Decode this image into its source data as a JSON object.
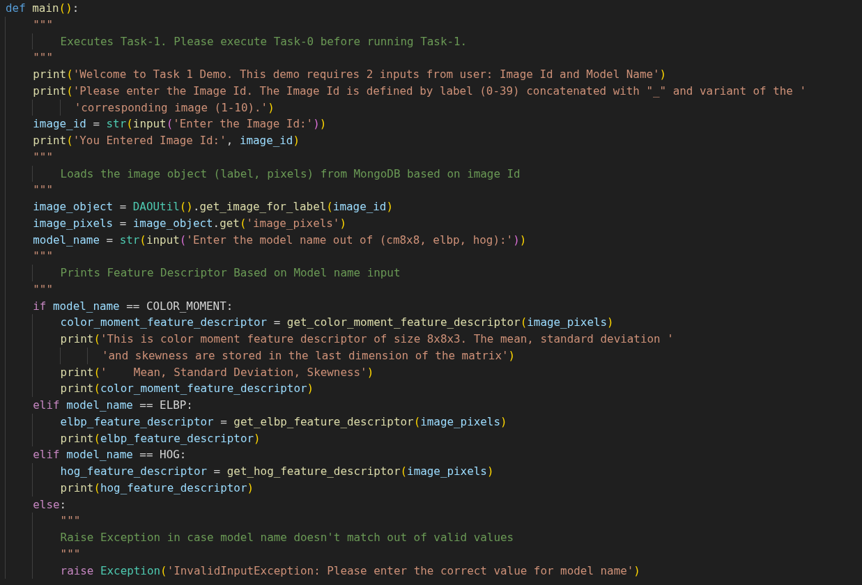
{
  "editor": {
    "lines": [
      {
        "tokens": [
          {
            "kind": "keyword",
            "text": "def "
          },
          {
            "kind": "function",
            "text": "main"
          },
          {
            "kind": "bracket1",
            "text": "()"
          },
          {
            "kind": "plain",
            "text": ":"
          }
        ]
      },
      {
        "tokens": [
          {
            "kind": "string",
            "text": "    \"\"\""
          }
        ]
      },
      {
        "tokens": [
          {
            "kind": "docstring",
            "text": "        Executes Task-1. Please execute Task-0 before running Task-1."
          }
        ]
      },
      {
        "tokens": [
          {
            "kind": "string",
            "text": "    \"\"\""
          }
        ]
      },
      {
        "tokens": [
          {
            "kind": "function",
            "text": "    print"
          },
          {
            "kind": "bracket1",
            "text": "("
          },
          {
            "kind": "string",
            "text": "'Welcome to Task 1 Demo. This demo requires 2 inputs from user: Image Id and Model Name'"
          },
          {
            "kind": "bracket1",
            "text": ")"
          }
        ]
      },
      {
        "tokens": [
          {
            "kind": "function",
            "text": "    print"
          },
          {
            "kind": "bracket1",
            "text": "("
          },
          {
            "kind": "string",
            "text": "'Please enter the Image Id. The Image Id is defined by label (0-39) concatenated with \"_\" and variant of the '"
          }
        ]
      },
      {
        "tokens": [
          {
            "kind": "string",
            "text": "          'corresponding image (1-10).'"
          },
          {
            "kind": "bracket1",
            "text": ")"
          }
        ]
      },
      {
        "tokens": [
          {
            "kind": "variable",
            "text": "    image_id"
          },
          {
            "kind": "plain",
            "text": " = "
          },
          {
            "kind": "class",
            "text": "str"
          },
          {
            "kind": "bracket1",
            "text": "("
          },
          {
            "kind": "function",
            "text": "input"
          },
          {
            "kind": "bracket2",
            "text": "("
          },
          {
            "kind": "string",
            "text": "'Enter the Image Id:'"
          },
          {
            "kind": "bracket2",
            "text": ")"
          },
          {
            "kind": "bracket1",
            "text": ")"
          }
        ]
      },
      {
        "tokens": [
          {
            "kind": "function",
            "text": "    print"
          },
          {
            "kind": "bracket1",
            "text": "("
          },
          {
            "kind": "string",
            "text": "'You Entered Image Id:'"
          },
          {
            "kind": "plain",
            "text": ", "
          },
          {
            "kind": "variable",
            "text": "image_id"
          },
          {
            "kind": "bracket1",
            "text": ")"
          }
        ]
      },
      {
        "tokens": [
          {
            "kind": "string",
            "text": "    \"\"\""
          }
        ]
      },
      {
        "tokens": [
          {
            "kind": "docstring",
            "text": "        Loads the image object (label, pixels) from MongoDB based on image Id"
          }
        ]
      },
      {
        "tokens": [
          {
            "kind": "string",
            "text": "    \"\"\""
          }
        ]
      },
      {
        "tokens": [
          {
            "kind": "variable",
            "text": "    image_object"
          },
          {
            "kind": "plain",
            "text": " = "
          },
          {
            "kind": "class",
            "text": "DAOUtil"
          },
          {
            "kind": "bracket1",
            "text": "()"
          },
          {
            "kind": "plain",
            "text": "."
          },
          {
            "kind": "function",
            "text": "get_image_for_label"
          },
          {
            "kind": "bracket1",
            "text": "("
          },
          {
            "kind": "variable",
            "text": "image_id"
          },
          {
            "kind": "bracket1",
            "text": ")"
          }
        ]
      },
      {
        "tokens": [
          {
            "kind": "variable",
            "text": "    image_pixels"
          },
          {
            "kind": "plain",
            "text": " = "
          },
          {
            "kind": "variable",
            "text": "image_object"
          },
          {
            "kind": "plain",
            "text": "."
          },
          {
            "kind": "function",
            "text": "get"
          },
          {
            "kind": "bracket1",
            "text": "("
          },
          {
            "kind": "string",
            "text": "'image_pixels'"
          },
          {
            "kind": "bracket1",
            "text": ")"
          }
        ]
      },
      {
        "tokens": [
          {
            "kind": "variable",
            "text": "    model_name"
          },
          {
            "kind": "plain",
            "text": " = "
          },
          {
            "kind": "class",
            "text": "str"
          },
          {
            "kind": "bracket1",
            "text": "("
          },
          {
            "kind": "function",
            "text": "input"
          },
          {
            "kind": "bracket2",
            "text": "("
          },
          {
            "kind": "string",
            "text": "'Enter the model name out of (cm8x8, elbp, hog):'"
          },
          {
            "kind": "bracket2",
            "text": ")"
          },
          {
            "kind": "bracket1",
            "text": ")"
          }
        ]
      },
      {
        "tokens": [
          {
            "kind": "string",
            "text": "    \"\"\""
          }
        ]
      },
      {
        "tokens": [
          {
            "kind": "docstring",
            "text": "        Prints Feature Descriptor Based on Model name input"
          }
        ]
      },
      {
        "tokens": [
          {
            "kind": "string",
            "text": "    \"\"\""
          }
        ]
      },
      {
        "tokens": [
          {
            "kind": "control",
            "text": "    if "
          },
          {
            "kind": "variable",
            "text": "model_name"
          },
          {
            "kind": "plain",
            "text": " == COLOR_MOMENT:"
          }
        ]
      },
      {
        "tokens": [
          {
            "kind": "variable",
            "text": "        color_moment_feature_descriptor"
          },
          {
            "kind": "plain",
            "text": " = "
          },
          {
            "kind": "function",
            "text": "get_color_moment_feature_descriptor"
          },
          {
            "kind": "bracket1",
            "text": "("
          },
          {
            "kind": "variable",
            "text": "image_pixels"
          },
          {
            "kind": "bracket1",
            "text": ")"
          }
        ]
      },
      {
        "tokens": [
          {
            "kind": "function",
            "text": "        print"
          },
          {
            "kind": "bracket1",
            "text": "("
          },
          {
            "kind": "string",
            "text": "'This is color moment feature descriptor of size 8x8x3. The mean, standard deviation '"
          }
        ]
      },
      {
        "tokens": [
          {
            "kind": "string",
            "text": "              'and skewness are stored in the last dimension of the matrix'"
          },
          {
            "kind": "bracket1",
            "text": ")"
          }
        ]
      },
      {
        "tokens": [
          {
            "kind": "function",
            "text": "        print"
          },
          {
            "kind": "bracket1",
            "text": "("
          },
          {
            "kind": "string",
            "text": "'    Mean, Standard Deviation, Skewness'"
          },
          {
            "kind": "bracket1",
            "text": ")"
          }
        ]
      },
      {
        "tokens": [
          {
            "kind": "function",
            "text": "        print"
          },
          {
            "kind": "bracket1",
            "text": "("
          },
          {
            "kind": "variable",
            "text": "color_moment_feature_descriptor"
          },
          {
            "kind": "bracket1",
            "text": ")"
          }
        ]
      },
      {
        "tokens": [
          {
            "kind": "control",
            "text": "    elif "
          },
          {
            "kind": "variable",
            "text": "model_name"
          },
          {
            "kind": "plain",
            "text": " == ELBP:"
          }
        ]
      },
      {
        "tokens": [
          {
            "kind": "variable",
            "text": "        elbp_feature_descriptor"
          },
          {
            "kind": "plain",
            "text": " = "
          },
          {
            "kind": "function",
            "text": "get_elbp_feature_descriptor"
          },
          {
            "kind": "bracket1",
            "text": "("
          },
          {
            "kind": "variable",
            "text": "image_pixels"
          },
          {
            "kind": "bracket1",
            "text": ")"
          }
        ]
      },
      {
        "tokens": [
          {
            "kind": "function",
            "text": "        print"
          },
          {
            "kind": "bracket1",
            "text": "("
          },
          {
            "kind": "variable",
            "text": "elbp_feature_descriptor"
          },
          {
            "kind": "bracket1",
            "text": ")"
          }
        ]
      },
      {
        "tokens": [
          {
            "kind": "control",
            "text": "    elif "
          },
          {
            "kind": "variable",
            "text": "model_name"
          },
          {
            "kind": "plain",
            "text": " == HOG:"
          }
        ]
      },
      {
        "tokens": [
          {
            "kind": "variable",
            "text": "        hog_feature_descriptor"
          },
          {
            "kind": "plain",
            "text": " = "
          },
          {
            "kind": "function",
            "text": "get_hog_feature_descriptor"
          },
          {
            "kind": "bracket1",
            "text": "("
          },
          {
            "kind": "variable",
            "text": "image_pixels"
          },
          {
            "kind": "bracket1",
            "text": ")"
          }
        ]
      },
      {
        "tokens": [
          {
            "kind": "function",
            "text": "        print"
          },
          {
            "kind": "bracket1",
            "text": "("
          },
          {
            "kind": "variable",
            "text": "hog_feature_descriptor"
          },
          {
            "kind": "bracket1",
            "text": ")"
          }
        ]
      },
      {
        "tokens": [
          {
            "kind": "control",
            "text": "    else"
          },
          {
            "kind": "plain",
            "text": ":"
          }
        ]
      },
      {
        "tokens": [
          {
            "kind": "string",
            "text": "        \"\"\""
          }
        ]
      },
      {
        "tokens": [
          {
            "kind": "docstring",
            "text": "        Raise Exception in case model name doesn't match out of valid values"
          }
        ]
      },
      {
        "tokens": [
          {
            "kind": "string",
            "text": "        \"\"\""
          }
        ]
      },
      {
        "tokens": [
          {
            "kind": "control",
            "text": "        raise "
          },
          {
            "kind": "class",
            "text": "Exception"
          },
          {
            "kind": "bracket1",
            "text": "("
          },
          {
            "kind": "string",
            "text": "'InvalidInputException: Please enter the correct value for model name'"
          },
          {
            "kind": "bracket1",
            "text": ")"
          }
        ]
      }
    ]
  }
}
